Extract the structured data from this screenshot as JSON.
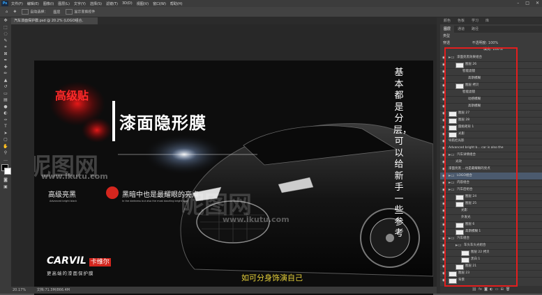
{
  "menubar": {
    "logo": "Ps",
    "items": [
      "文件(F)",
      "编辑(E)",
      "图像(I)",
      "图层(L)",
      "文字(Y)",
      "选择(S)",
      "滤镜(T)",
      "3D(D)",
      "视图(V)",
      "窗口(W)",
      "帮助(H)"
    ]
  },
  "options": {
    "auto_select": "自动选择：",
    "layer_select": "图层",
    "show_transform": "显示变换控件"
  },
  "document": {
    "tab_title": "汽车漆面保护膜.psd @ 20.2% (LOGO组合, RGB/8#) ×"
  },
  "artwork": {
    "calligraphy": "高级贴",
    "headline": "漆面隐形膜",
    "subtitle_left": "高级亮黑",
    "subtitle_right": "黑暗中也是最耀眼的亮点",
    "small_left": "Advanced bright black",
    "small_right": "In the darkness but also the most dazzling bright spot",
    "logo_text": "CARVIL",
    "logo_badge": "卡维尔",
    "slogan": "更高端的漆面保护膜",
    "vertical_note": "基本都是分层，可以给新手一些参考"
  },
  "watermarks": {
    "big": "昵图网",
    "url": "www.ikutu.com"
  },
  "caption": "如可分身饰演自己",
  "status": {
    "zoom": "20.17%",
    "doc": "文档:71.3M/866.4M"
  },
  "panels": {
    "top_tabs": [
      "颜色",
      "色板",
      "学习",
      "库"
    ],
    "layer_tabs": [
      "图层",
      "通道",
      "路径"
    ],
    "kind": "类型",
    "blend": "穿透",
    "opacity_label": "不透明度:",
    "opacity": "100%",
    "fill_label": "填充:",
    "fill": "100%",
    "layers": [
      "漆面亮黑效果组合",
      "图层 26",
      "智能滤镜",
      "高斯模糊",
      "图层 拷贝",
      "智能滤镜",
      "动感模糊",
      "高斯模糊",
      "图层 27",
      "图层 28",
      "圆角矩形 1",
      "光影",
      "导航栏光影",
      "Advanced bright b... car is also the",
      "汽车详情组合",
      "光效",
      "漆面亮黑 ...也是最耀眼的亮点",
      "LOGO组合",
      "内容组合",
      "汽车后组合",
      "图层 24",
      "图层 25",
      "光影",
      "外发光",
      "图层 6",
      "高斯模糊 1",
      "汽车组合",
      "车头车头光组合",
      "图层 22 拷贝",
      "黑白 1",
      "图层 21",
      "图层 23",
      "背景"
    ]
  },
  "colors": {
    "accent_red": "#e41e1e",
    "caption_yellow": "#e8d23a",
    "panel_bg": "#3b3b3b"
  }
}
